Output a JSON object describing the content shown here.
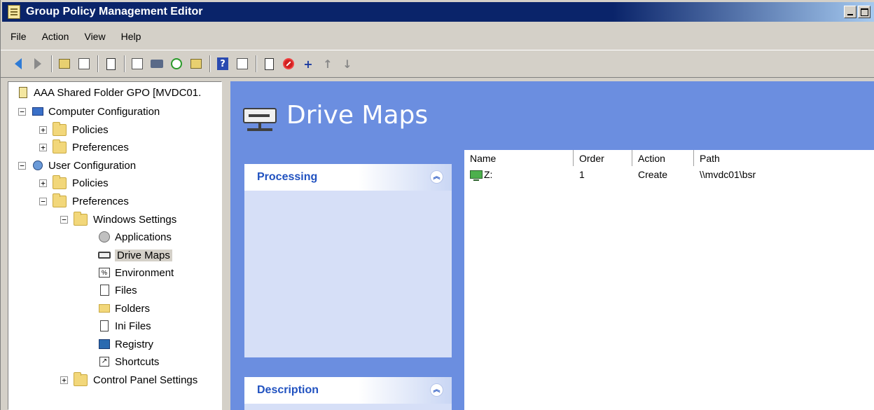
{
  "window": {
    "title": "Group Policy Management Editor"
  },
  "menu": [
    "File",
    "Action",
    "View",
    "Help"
  ],
  "tree": {
    "root": "AAA Shared Folder GPO [MVDC01.",
    "computer_config": "Computer Configuration",
    "cc_policies": "Policies",
    "cc_preferences": "Preferences",
    "user_config": "User Configuration",
    "uc_policies": "Policies",
    "uc_preferences": "Preferences",
    "windows_settings": "Windows Settings",
    "applications": "Applications",
    "drive_maps": "Drive Maps",
    "environment": "Environment",
    "files": "Files",
    "folders": "Folders",
    "ini_files": "Ini Files",
    "registry": "Registry",
    "shortcuts": "Shortcuts",
    "control_panel_settings": "Control Panel Settings"
  },
  "content": {
    "header_title": "Drive Maps",
    "processing_title": "Processing",
    "description_title": "Description",
    "columns": [
      "Name",
      "Order",
      "Action",
      "Path"
    ],
    "rows": [
      {
        "name": "Z:",
        "order": "1",
        "action": "Create",
        "path": "\\\\mvdc01\\bsr"
      }
    ]
  },
  "colors": {
    "titlebar": "#0a246a",
    "content_bg": "#6b8ee0",
    "panel_title": "#2152c0"
  }
}
